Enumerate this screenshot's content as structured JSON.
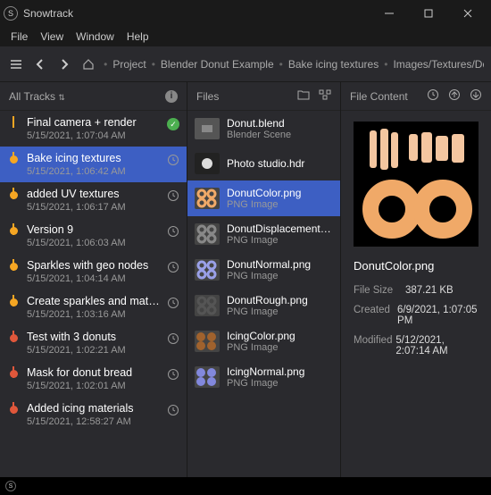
{
  "window": {
    "title": "Snowtrack"
  },
  "menu": [
    "File",
    "View",
    "Window",
    "Help"
  ],
  "crumbs": [
    "Project",
    "Blender Donut Example",
    "Bake icing textures",
    "Images/Textures/DonutColor.pn"
  ],
  "cols": {
    "tracks": "All Tracks",
    "files": "Files",
    "content": "File Content"
  },
  "tracks": [
    {
      "name": "Final camera + render",
      "date": "5/15/2021, 1:07:04 AM",
      "dot": "g",
      "side": "check"
    },
    {
      "name": "Bake icing textures",
      "date": "5/15/2021, 1:06:42 AM",
      "dot": "y",
      "sel": true,
      "side": "hist"
    },
    {
      "name": "added UV textures",
      "date": "5/15/2021, 1:06:17 AM",
      "dot": "y",
      "side": "hist"
    },
    {
      "name": "Version 9",
      "date": "5/15/2021, 1:06:03 AM",
      "dot": "y",
      "side": "hist"
    },
    {
      "name": "Sparkles with geo nodes",
      "date": "5/15/2021, 1:04:14 AM",
      "dot": "y",
      "side": "hist"
    },
    {
      "name": "Create sparkles and materials",
      "date": "5/15/2021, 1:03:16 AM",
      "dot": "y",
      "side": "hist"
    },
    {
      "name": "Test with 3 donuts",
      "date": "5/15/2021, 1:02:21 AM",
      "dot": "r",
      "side": "hist"
    },
    {
      "name": "Mask for donut bread",
      "date": "5/15/2021, 1:02:01 AM",
      "dot": "r",
      "side": "hist"
    },
    {
      "name": "Added icing materials",
      "date": "5/15/2021, 12:58:27 AM",
      "dot": "r",
      "side": "hist"
    }
  ],
  "files": [
    {
      "name": "Donut.blend",
      "type": "Blender Scene",
      "thumb": "blend"
    },
    {
      "name": "Photo studio.hdr",
      "type": "",
      "thumb": "hdr"
    },
    {
      "name": "DonutColor.png",
      "type": "PNG Image",
      "thumb": "donut-peach",
      "sel": true
    },
    {
      "name": "DonutDisplacement.png",
      "type": "PNG Image",
      "thumb": "donut-gray"
    },
    {
      "name": "DonutNormal.png",
      "type": "PNG Image",
      "thumb": "donut-blue"
    },
    {
      "name": "DonutRough.png",
      "type": "PNG Image",
      "thumb": "donut-dark"
    },
    {
      "name": "IcingColor.png",
      "type": "PNG Image",
      "thumb": "icing-brown"
    },
    {
      "name": "IcingNormal.png",
      "type": "PNG Image",
      "thumb": "icing-blue"
    }
  ],
  "preview": {
    "name": "DonutColor.png",
    "meta": [
      {
        "label": "File Size",
        "value": "387.21 KB"
      },
      {
        "label": "Created",
        "value": "6/9/2021, 1:07:05 PM"
      },
      {
        "label": "Modified",
        "value": "5/12/2021, 2:07:14 AM"
      }
    ]
  }
}
